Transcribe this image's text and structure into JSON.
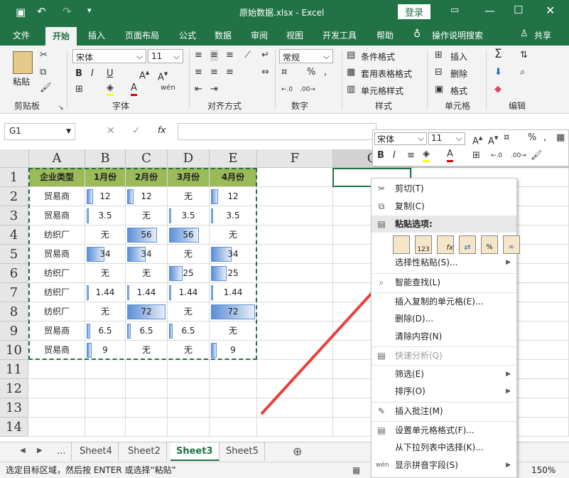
{
  "titlebar": {
    "title": "原始数据.xlsx - Excel",
    "login": "登录"
  },
  "tabs": [
    "文件",
    "开始",
    "插入",
    "页面布局",
    "公式",
    "数据",
    "审阅",
    "视图",
    "开发工具",
    "帮助",
    "操作说明搜索",
    "共享"
  ],
  "ribbon": {
    "paste": "粘贴",
    "clipboard": "剪贴板",
    "font_name": "宋体",
    "font_size": "11",
    "font_group": "字体",
    "align_group": "对齐方式",
    "num_format": "常规",
    "number_group": "数字",
    "cond_format": "条件格式",
    "table_format": "套用表格格式",
    "cell_style": "单元格样式",
    "styles_group": "样式",
    "insert": "插入",
    "delete": "删除",
    "format": "格式",
    "cells_group": "单元格",
    "edit_group": "编辑"
  },
  "formula": {
    "namebox": "G1",
    "fx": "fx"
  },
  "columns": [
    "A",
    "B",
    "C",
    "D",
    "E",
    "F",
    "G"
  ],
  "rows": [
    "1",
    "2",
    "3",
    "4",
    "5",
    "6",
    "7",
    "8",
    "9",
    "10",
    "11",
    "12",
    "13",
    "14"
  ],
  "table": {
    "header": [
      "企业类型",
      "1月份",
      "2月份",
      "3月份",
      "4月份"
    ],
    "rows": [
      [
        "贸易商",
        "12",
        "12",
        "无",
        "12"
      ],
      [
        "贸易商",
        "3.5",
        "无",
        "3.5",
        "3.5"
      ],
      [
        "纺织厂",
        "无",
        "56",
        "56",
        "无"
      ],
      [
        "贸易商",
        "34",
        "34",
        "无",
        "34"
      ],
      [
        "纺织厂",
        "无",
        "无",
        "25",
        "25"
      ],
      [
        "纺织厂",
        "1.44",
        "1.44",
        "1.44",
        "1.44"
      ],
      [
        "纺织厂",
        "无",
        "72",
        "无",
        "72"
      ],
      [
        "贸易商",
        "6.5",
        "6.5",
        "6.5",
        "无"
      ],
      [
        "贸易商",
        "9",
        "无",
        "无",
        "9"
      ]
    ],
    "data_bar_max": 72
  },
  "mini_toolbar": {
    "font": "宋体",
    "size": "11"
  },
  "context_menu": {
    "cut": "剪切(T)",
    "copy": "复制(C)",
    "paste_options": "粘贴选项:",
    "paste_special": "选择性粘贴(S)...",
    "smart_lookup": "智能查找(L)",
    "insert_copied": "插入复制的单元格(E)...",
    "delete": "删除(D)...",
    "clear": "清除内容(N)",
    "quick_analysis": "快速分析(Q)",
    "filter": "筛选(E)",
    "sort": "排序(O)",
    "insert_comment": "插入批注(M)",
    "format_cells": "设置单元格格式(F)...",
    "pick_list": "从下拉列表中选择(K)...",
    "phonetic": "显示拼音字段(S)"
  },
  "sheets": [
    "...",
    "Sheet4",
    "Sheet2",
    "Sheet3",
    "Sheet5"
  ],
  "status": {
    "message": "选定目标区域，然后按 ENTER 或选择“粘贴”",
    "zoom": "150%"
  },
  "colors": {
    "accent": "#217346",
    "header_fill": "#9bbb59",
    "data_bar": "#5b8fd6",
    "arrow": "#e8403a"
  }
}
